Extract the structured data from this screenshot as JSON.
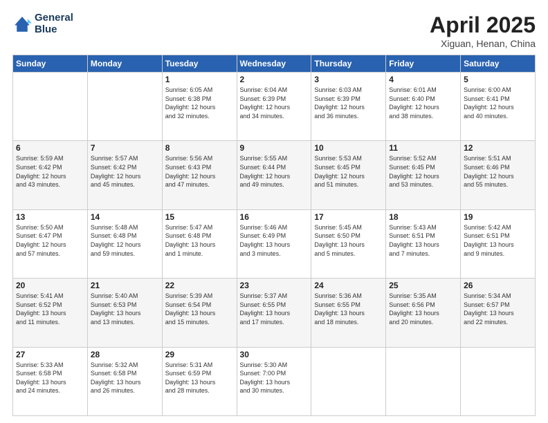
{
  "header": {
    "logo_line1": "General",
    "logo_line2": "Blue",
    "title": "April 2025",
    "subtitle": "Xiguan, Henan, China"
  },
  "days_of_week": [
    "Sunday",
    "Monday",
    "Tuesday",
    "Wednesday",
    "Thursday",
    "Friday",
    "Saturday"
  ],
  "weeks": [
    [
      {
        "day": "",
        "info": ""
      },
      {
        "day": "",
        "info": ""
      },
      {
        "day": "1",
        "info": "Sunrise: 6:05 AM\nSunset: 6:38 PM\nDaylight: 12 hours\nand 32 minutes."
      },
      {
        "day": "2",
        "info": "Sunrise: 6:04 AM\nSunset: 6:39 PM\nDaylight: 12 hours\nand 34 minutes."
      },
      {
        "day": "3",
        "info": "Sunrise: 6:03 AM\nSunset: 6:39 PM\nDaylight: 12 hours\nand 36 minutes."
      },
      {
        "day": "4",
        "info": "Sunrise: 6:01 AM\nSunset: 6:40 PM\nDaylight: 12 hours\nand 38 minutes."
      },
      {
        "day": "5",
        "info": "Sunrise: 6:00 AM\nSunset: 6:41 PM\nDaylight: 12 hours\nand 40 minutes."
      }
    ],
    [
      {
        "day": "6",
        "info": "Sunrise: 5:59 AM\nSunset: 6:42 PM\nDaylight: 12 hours\nand 43 minutes."
      },
      {
        "day": "7",
        "info": "Sunrise: 5:57 AM\nSunset: 6:42 PM\nDaylight: 12 hours\nand 45 minutes."
      },
      {
        "day": "8",
        "info": "Sunrise: 5:56 AM\nSunset: 6:43 PM\nDaylight: 12 hours\nand 47 minutes."
      },
      {
        "day": "9",
        "info": "Sunrise: 5:55 AM\nSunset: 6:44 PM\nDaylight: 12 hours\nand 49 minutes."
      },
      {
        "day": "10",
        "info": "Sunrise: 5:53 AM\nSunset: 6:45 PM\nDaylight: 12 hours\nand 51 minutes."
      },
      {
        "day": "11",
        "info": "Sunrise: 5:52 AM\nSunset: 6:45 PM\nDaylight: 12 hours\nand 53 minutes."
      },
      {
        "day": "12",
        "info": "Sunrise: 5:51 AM\nSunset: 6:46 PM\nDaylight: 12 hours\nand 55 minutes."
      }
    ],
    [
      {
        "day": "13",
        "info": "Sunrise: 5:50 AM\nSunset: 6:47 PM\nDaylight: 12 hours\nand 57 minutes."
      },
      {
        "day": "14",
        "info": "Sunrise: 5:48 AM\nSunset: 6:48 PM\nDaylight: 12 hours\nand 59 minutes."
      },
      {
        "day": "15",
        "info": "Sunrise: 5:47 AM\nSunset: 6:48 PM\nDaylight: 13 hours\nand 1 minute."
      },
      {
        "day": "16",
        "info": "Sunrise: 5:46 AM\nSunset: 6:49 PM\nDaylight: 13 hours\nand 3 minutes."
      },
      {
        "day": "17",
        "info": "Sunrise: 5:45 AM\nSunset: 6:50 PM\nDaylight: 13 hours\nand 5 minutes."
      },
      {
        "day": "18",
        "info": "Sunrise: 5:43 AM\nSunset: 6:51 PM\nDaylight: 13 hours\nand 7 minutes."
      },
      {
        "day": "19",
        "info": "Sunrise: 5:42 AM\nSunset: 6:51 PM\nDaylight: 13 hours\nand 9 minutes."
      }
    ],
    [
      {
        "day": "20",
        "info": "Sunrise: 5:41 AM\nSunset: 6:52 PM\nDaylight: 13 hours\nand 11 minutes."
      },
      {
        "day": "21",
        "info": "Sunrise: 5:40 AM\nSunset: 6:53 PM\nDaylight: 13 hours\nand 13 minutes."
      },
      {
        "day": "22",
        "info": "Sunrise: 5:39 AM\nSunset: 6:54 PM\nDaylight: 13 hours\nand 15 minutes."
      },
      {
        "day": "23",
        "info": "Sunrise: 5:37 AM\nSunset: 6:55 PM\nDaylight: 13 hours\nand 17 minutes."
      },
      {
        "day": "24",
        "info": "Sunrise: 5:36 AM\nSunset: 6:55 PM\nDaylight: 13 hours\nand 18 minutes."
      },
      {
        "day": "25",
        "info": "Sunrise: 5:35 AM\nSunset: 6:56 PM\nDaylight: 13 hours\nand 20 minutes."
      },
      {
        "day": "26",
        "info": "Sunrise: 5:34 AM\nSunset: 6:57 PM\nDaylight: 13 hours\nand 22 minutes."
      }
    ],
    [
      {
        "day": "27",
        "info": "Sunrise: 5:33 AM\nSunset: 6:58 PM\nDaylight: 13 hours\nand 24 minutes."
      },
      {
        "day": "28",
        "info": "Sunrise: 5:32 AM\nSunset: 6:58 PM\nDaylight: 13 hours\nand 26 minutes."
      },
      {
        "day": "29",
        "info": "Sunrise: 5:31 AM\nSunset: 6:59 PM\nDaylight: 13 hours\nand 28 minutes."
      },
      {
        "day": "30",
        "info": "Sunrise: 5:30 AM\nSunset: 7:00 PM\nDaylight: 13 hours\nand 30 minutes."
      },
      {
        "day": "",
        "info": ""
      },
      {
        "day": "",
        "info": ""
      },
      {
        "day": "",
        "info": ""
      }
    ]
  ]
}
